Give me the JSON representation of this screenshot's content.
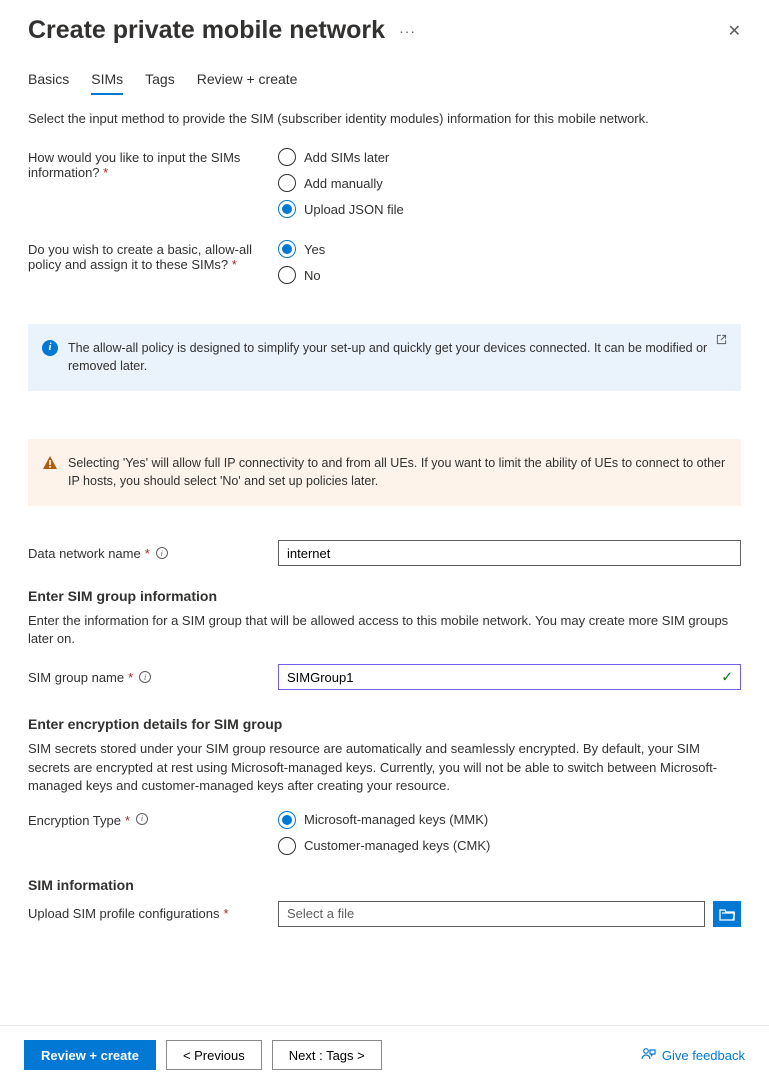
{
  "header": {
    "title": "Create private mobile network"
  },
  "tabs": [
    "Basics",
    "SIMs",
    "Tags",
    "Review + create"
  ],
  "active_tab": "SIMs",
  "intro": "Select the input method to provide the SIM (subscriber identity modules) information for this mobile network.",
  "q1": {
    "label": "How would you like to input the SIMs information?",
    "options": [
      "Add SIMs later",
      "Add manually",
      "Upload JSON file"
    ],
    "selected": "Upload JSON file"
  },
  "q2": {
    "label": "Do you wish to create a basic, allow-all policy and assign it to these SIMs?",
    "options": [
      "Yes",
      "No"
    ],
    "selected": "Yes"
  },
  "info_callout": "The allow-all policy is designed to simplify your set-up and quickly get your devices connected. It can be modified or removed later.",
  "warn_callout": "Selecting 'Yes' will allow full IP connectivity to and from all UEs. If you want to limit the ability of UEs to connect to other IP hosts, you should select 'No' and set up policies later.",
  "data_network": {
    "label": "Data network name",
    "value": "internet"
  },
  "sim_group_section": {
    "title": "Enter SIM group information",
    "desc": "Enter the information for a SIM group that will be allowed access to this mobile network. You may create more SIM groups later on.",
    "name_label": "SIM group name",
    "name_value": "SIMGroup1"
  },
  "encryption_section": {
    "title": "Enter encryption details for SIM group",
    "desc": "SIM secrets stored under your SIM group resource are automatically and seamlessly encrypted. By default, your SIM secrets are encrypted at rest using Microsoft-managed keys. Currently, you will not be able to switch between Microsoft-managed keys and customer-managed keys after creating your resource.",
    "type_label": "Encryption Type",
    "options": [
      "Microsoft-managed keys (MMK)",
      "Customer-managed keys (CMK)"
    ],
    "selected": "Microsoft-managed keys (MMK)"
  },
  "sim_info_section": {
    "title": "SIM information",
    "upload_label": "Upload SIM profile configurations",
    "placeholder": "Select a file"
  },
  "footer": {
    "review": "Review + create",
    "previous": "< Previous",
    "next": "Next : Tags >",
    "feedback": "Give feedback"
  }
}
